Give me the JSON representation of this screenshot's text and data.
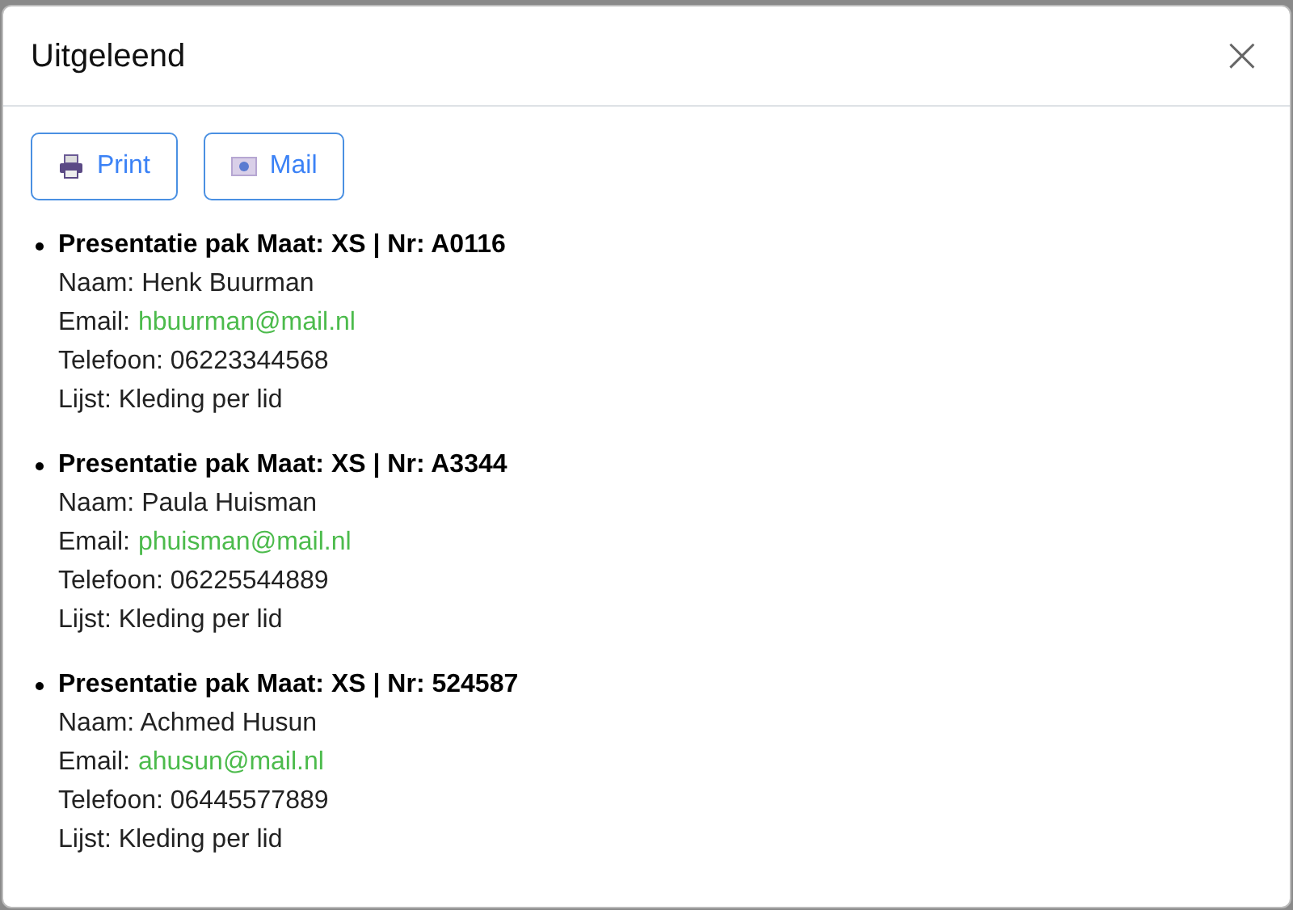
{
  "dialog": {
    "title": "Uitgeleend",
    "close": "×"
  },
  "buttons": [
    {
      "kind": "print",
      "label": "Print"
    },
    {
      "kind": "mail",
      "label": "Mail"
    }
  ],
  "items": [
    {
      "heading": "Presentatie pak Maat: XS | Nr: A0116",
      "lines": [
        {
          "kind": "text",
          "text": "Naam: Henk Buurman"
        },
        {
          "kind": "email",
          "label": "Email:",
          "link": "hbuurman@mail.nl"
        },
        {
          "kind": "text",
          "text": "Telefoon: 06223344568"
        },
        {
          "kind": "text",
          "text": "Lijst: Kleding per lid"
        }
      ]
    },
    {
      "heading": "Presentatie pak Maat: XS | Nr: A3344",
      "lines": [
        {
          "kind": "text",
          "text": "Naam: Paula Huisman"
        },
        {
          "kind": "email",
          "label": "Email:",
          "link": "phuisman@mail.nl"
        },
        {
          "kind": "text",
          "text": "Telefoon: 06225544889"
        },
        {
          "kind": "text",
          "text": "Lijst: Kleding per lid"
        }
      ]
    },
    {
      "heading": "Presentatie pak Maat: XS | Nr: 524587",
      "lines": [
        {
          "kind": "text",
          "text": "Naam: Achmed Husun"
        },
        {
          "kind": "email",
          "label": "Email:",
          "link": "ahusun@mail.nl"
        },
        {
          "kind": "text",
          "text": "Telefoon: 06445577889"
        },
        {
          "kind": "text",
          "text": "Lijst: Kleding per lid"
        }
      ]
    }
  ]
}
